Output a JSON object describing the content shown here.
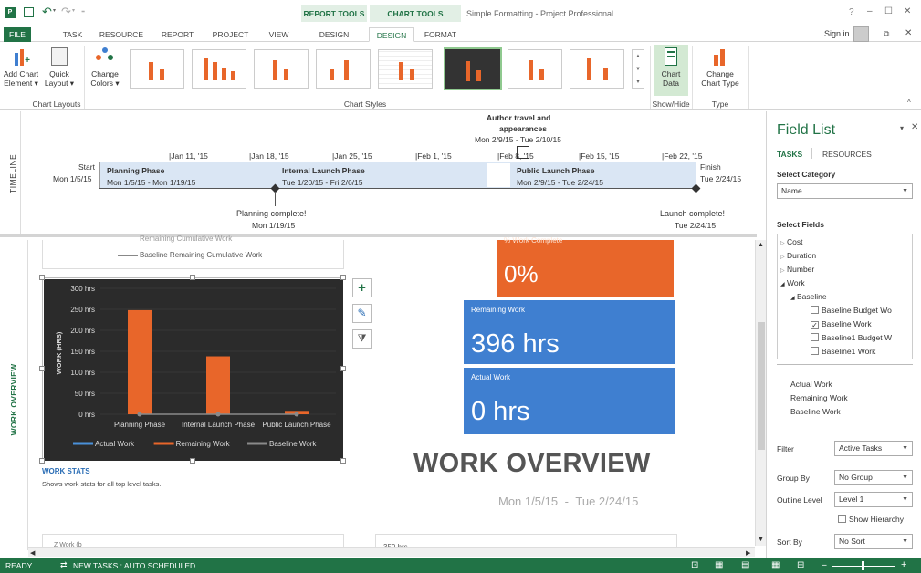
{
  "titlebar": {
    "title": "Simple Formatting - Project Professional",
    "help": "?",
    "min": "–",
    "max": "☐",
    "close": "✕",
    "signin": "Sign in",
    "contexts": {
      "report_tools": "REPORT TOOLS",
      "chart_tools": "CHART TOOLS"
    }
  },
  "tabs": [
    "FILE",
    "TASK",
    "RESOURCE",
    "REPORT",
    "PROJECT",
    "VIEW",
    "DESIGN",
    "DESIGN",
    "FORMAT"
  ],
  "ribbon": {
    "add_chart_element": "Add Chart Element ▾",
    "add_chart_element_l1": "Add Chart",
    "add_chart_element_l2": "Element ▾",
    "quick_layout_l1": "Quick",
    "quick_layout_l2": "Layout ▾",
    "change_colors_l1": "Change",
    "change_colors_l2": "Colors ▾",
    "chart_data_l1": "Chart",
    "chart_data_l2": "Data",
    "change_chart_type_l1": "Change",
    "change_chart_type_l2": "Chart Type",
    "groups": {
      "chart_layouts": "Chart Layouts",
      "chart_styles": "Chart Styles",
      "show_hide": "Show/Hide",
      "type": "Type"
    }
  },
  "timeline": {
    "side_label": "TIMELINE",
    "start_label": "Start",
    "start_date": "Mon 1/5/15",
    "finish_label": "Finish",
    "finish_date": "Tue 2/24/15",
    "ticks": [
      "Jan 11, '15",
      "Jan 18, '15",
      "Jan 25, '15",
      "Feb 1, '15",
      "Feb 8, '15",
      "Feb 15, '15",
      "Feb 22, '15"
    ],
    "callout_l1": "Author travel and",
    "callout_l2": "appearances",
    "callout_l3": "Mon 2/9/15 - Tue 2/10/15",
    "phases": [
      {
        "name": "Planning Phase",
        "dates": "Mon 1/5/15 - Mon 1/19/15"
      },
      {
        "name": "Internal Launch Phase",
        "dates": "Tue 1/20/15 - Fri 2/6/15"
      },
      {
        "name": "Public Launch Phase",
        "dates": "Mon 2/9/15 - Tue 2/24/15"
      }
    ],
    "milestones": [
      {
        "name": "Planning complete!",
        "date": "Mon 1/19/15"
      },
      {
        "name": "Launch complete!",
        "date": "Tue 2/24/15"
      }
    ]
  },
  "overview": {
    "side_label": "WORK OVERVIEW",
    "top_chart_legend_partial": "Remaining Cumulative Work",
    "top_chart_legend": "Baseline Remaining Cumulative Work",
    "work_stats_title": "WORK STATS",
    "work_stats_desc": "Shows work stats for all top level tasks.",
    "big_title": "WORK OVERVIEW",
    "date_start": "Mon 1/5/15",
    "date_sep": "-",
    "date_end": "Tue 2/24/15",
    "pct_label": "% Work Complete",
    "pct_value": "0%",
    "remaining_label": "Remaining Work",
    "remaining_value": "396 hrs",
    "actual_label": "Actual Work",
    "actual_value": "0 hrs",
    "bottom_partial_1": "Z   Work (b",
    "bottom_partial_2": "350 hrs"
  },
  "chart_data": {
    "type": "bar",
    "categories": [
      "Planning Phase",
      "Internal Launch Phase",
      "Public Launch Phase"
    ],
    "series": [
      {
        "name": "Actual Work",
        "values": [
          0,
          0,
          0
        ],
        "color": "#4a90d9"
      },
      {
        "name": "Remaining Work",
        "values": [
          248,
          138,
          8
        ],
        "color": "#e8662a"
      },
      {
        "name": "Baseline Work",
        "values": [
          0,
          0,
          0
        ],
        "color": "#8a8a8a"
      }
    ],
    "ylabel": "WORK (HRS)",
    "yticks": [
      "0 hrs",
      "50 hrs",
      "100 hrs",
      "150 hrs",
      "200 hrs",
      "250 hrs",
      "300 hrs"
    ],
    "ylim": [
      0,
      300
    ],
    "legend_position": "bottom",
    "grid": true,
    "background": "#2b2b2b"
  },
  "fieldlist": {
    "title": "Field List",
    "tab_tasks": "TASKS",
    "tab_resources": "RESOURCES",
    "select_category_label": "Select Category",
    "category_value": "Name",
    "select_fields_label": "Select Fields",
    "tree": [
      {
        "label": "Cost",
        "expanded": false
      },
      {
        "label": "Duration",
        "expanded": false
      },
      {
        "label": "Number",
        "expanded": false
      },
      {
        "label": "Work",
        "expanded": true
      },
      {
        "label": "Baseline",
        "expanded": true
      }
    ],
    "checkboxes": [
      {
        "label": "Baseline Budget Wo",
        "checked": false
      },
      {
        "label": "Baseline Work",
        "checked": true
      },
      {
        "label": "Baseline1 Budget W",
        "checked": false
      },
      {
        "label": "Baseline1 Work",
        "checked": false
      }
    ],
    "selected_fields": [
      "Actual Work",
      "Remaining Work",
      "Baseline Work"
    ],
    "filter_label": "Filter",
    "filter_value": "Active Tasks",
    "groupby_label": "Group By",
    "groupby_value": "No Group",
    "outline_label": "Outline Level",
    "outline_value": "Level 1",
    "show_hierarchy": "Show Hierarchy",
    "sortby_label": "Sort By",
    "sortby_value": "No Sort"
  },
  "statusbar": {
    "ready": "READY",
    "new_tasks": "NEW TASKS : AUTO SCHEDULED"
  },
  "colors": {
    "brand_green": "#217346",
    "orange": "#e8662a",
    "blue_card": "#3f7fd0",
    "chart_bg": "#2b2b2b",
    "timeline_bar": "#dae6f4"
  }
}
